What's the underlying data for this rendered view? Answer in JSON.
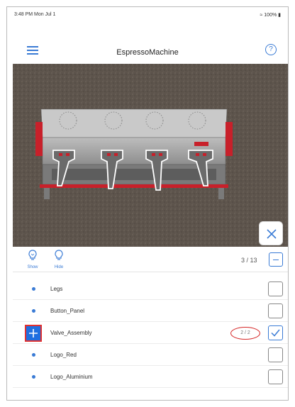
{
  "status_bar": {
    "time_date": "3:48 PM  Mon Jul 1",
    "battery": "100%"
  },
  "nav": {
    "title": "EspressoMachine",
    "menu_icon": "hamburger-icon",
    "help_icon": "question-circle-icon",
    "help_glyph": "?"
  },
  "viewer": {
    "close_icon": "close-x-icon"
  },
  "toolbar": {
    "show_label": "Show",
    "hide_label": "Hide",
    "count": "3 / 13"
  },
  "parts": [
    {
      "name": "Legs",
      "checked": false
    },
    {
      "name": "Button_Panel",
      "checked": false
    },
    {
      "name": "Valve_Assembly",
      "checked": true,
      "badge": "2 / 2",
      "expandable": true
    },
    {
      "name": "Logo_Red",
      "checked": false
    },
    {
      "name": "Logo_Aluminium",
      "checked": false
    }
  ],
  "colors": {
    "accent": "#3a7bd5",
    "highlight_red": "#d62828",
    "machine_red": "#c8202a"
  }
}
